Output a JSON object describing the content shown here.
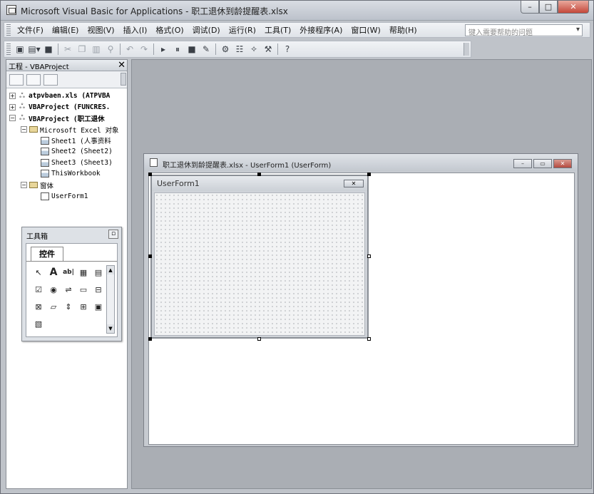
{
  "window": {
    "title": "Microsoft Visual Basic for Applications - 职工退休到龄提醒表.xlsx",
    "min": "–",
    "max": "□",
    "close": "✕"
  },
  "menubar": {
    "items": [
      "文件(F)",
      "编辑(E)",
      "视图(V)",
      "插入(I)",
      "格式(O)",
      "调试(D)",
      "运行(R)",
      "工具(T)",
      "外接程序(A)",
      "窗口(W)",
      "帮助(H)"
    ],
    "help_placeholder": "键入需要帮助的问题"
  },
  "toolbar": {
    "icons": [
      "excel-view-icon",
      "insert-userform-icon",
      "save-icon",
      "cut-icon",
      "copy-icon",
      "paste-icon",
      "find-icon",
      "undo-icon",
      "redo-icon",
      "run-icon",
      "break-icon",
      "reset-icon",
      "design-mode-icon",
      "project-explorer-icon",
      "properties-icon",
      "object-browser-icon",
      "toolbox-icon",
      "help-icon"
    ]
  },
  "project": {
    "title": "工程 - VBAProject",
    "close": "✕",
    "tree": [
      {
        "indent": 0,
        "box": "+",
        "icon": "vba-project",
        "label": "atpvbaen.xls (ATPVBA",
        "bold": true
      },
      {
        "indent": 0,
        "box": "+",
        "icon": "vba-project",
        "label": "VBAProject (FUNCRES.",
        "bold": true
      },
      {
        "indent": 0,
        "box": "−",
        "icon": "vba-project",
        "label": "VBAProject (职工退休",
        "bold": true
      },
      {
        "indent": 1,
        "box": "−",
        "icon": "folder",
        "label": "Microsoft Excel 对象",
        "bold": false
      },
      {
        "indent": 2,
        "box": "",
        "icon": "sheet",
        "label": "Sheet1 (人事资料",
        "bold": false
      },
      {
        "indent": 2,
        "box": "",
        "icon": "sheet",
        "label": "Sheet2 (Sheet2)",
        "bold": false
      },
      {
        "indent": 2,
        "box": "",
        "icon": "sheet",
        "label": "Sheet3 (Sheet3)",
        "bold": false
      },
      {
        "indent": 2,
        "box": "",
        "icon": "workbook",
        "label": "ThisWorkbook",
        "bold": false
      },
      {
        "indent": 1,
        "box": "−",
        "icon": "folder",
        "label": "窗体",
        "bold": false
      },
      {
        "indent": 2,
        "box": "",
        "icon": "form",
        "label": "UserForm1",
        "bold": false
      }
    ]
  },
  "toolbox": {
    "title": "工具箱",
    "close": "▫",
    "tab": "控件",
    "controls": [
      "↖",
      "A",
      "ab|",
      "▦",
      "▤",
      "☑",
      "◉",
      "⇌",
      "▭",
      "⊟",
      "⊠",
      "▱",
      "⇕",
      "⊞",
      "▣",
      "▧"
    ]
  },
  "designer": {
    "title": "职工退休到龄提醒表.xlsx - UserForm1 (UserForm)",
    "min": "–",
    "max": "▭",
    "close": "✕"
  },
  "userform": {
    "title": "UserForm1",
    "close": "✕"
  }
}
